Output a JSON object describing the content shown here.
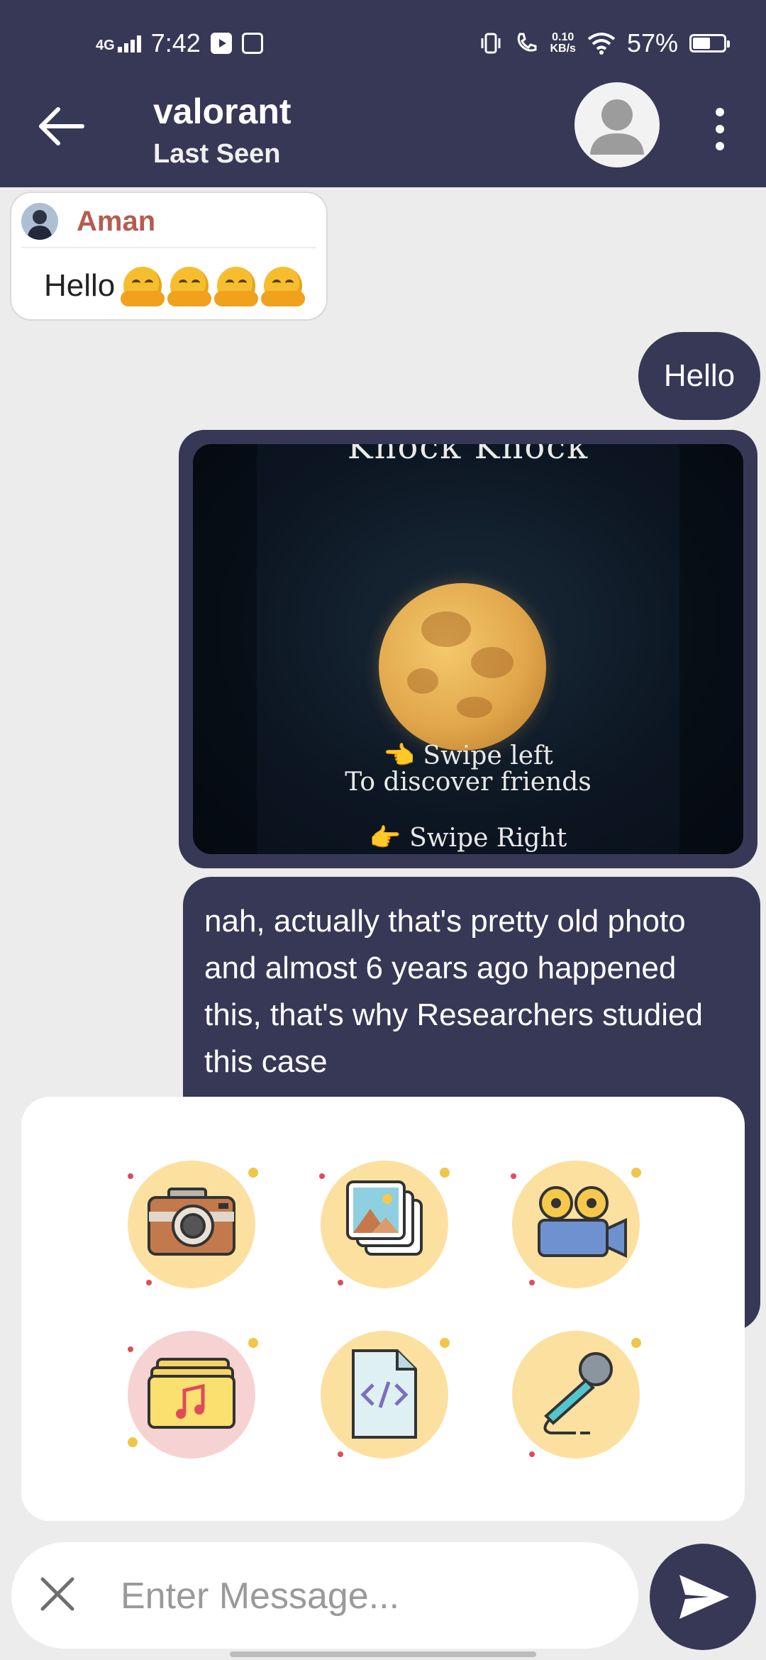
{
  "status_bar": {
    "network": "4G",
    "time": "7:42",
    "data_speed_top": "0.10",
    "data_speed_bottom": "KB/s",
    "battery": "57%",
    "battery_level": 0.57
  },
  "header": {
    "title": "valorant",
    "subtitle": "Last Seen"
  },
  "messages": {
    "incoming": {
      "sender": "Aman",
      "text": "Hello"
    },
    "outgoing_hello": "Hello",
    "image_caption": {
      "top": "Knock Knock",
      "line1": "👈 Swipe left",
      "line2": "To discover friends",
      "line3": "👉 Swipe Right"
    },
    "outgoing_long": "nah, actually that's pretty old photo and almost 6 years ago happened this, that's why Researchers studied this case"
  },
  "composer": {
    "placeholder": "Enter Message..."
  },
  "colors": {
    "primary": "#373856",
    "background": "#ececec",
    "sender": "#b45d4f"
  }
}
